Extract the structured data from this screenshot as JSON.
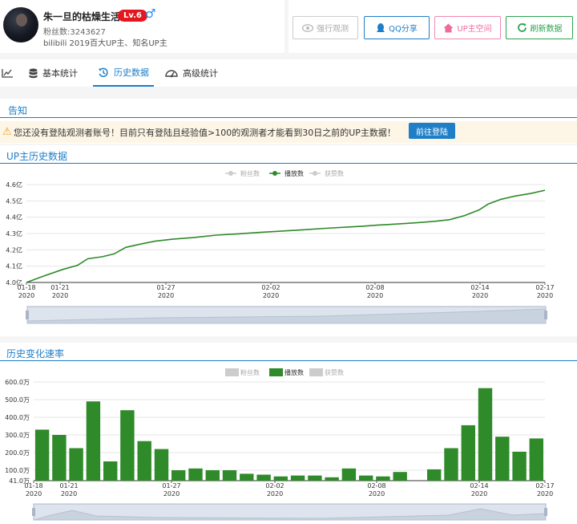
{
  "profile": {
    "name": "朱一旦的枯燥生活",
    "level": "Lv.6",
    "gender_symbol": "♂",
    "fans": "粉丝数:3243627",
    "description": "bilibili 2019百大UP主、知名UP主"
  },
  "actions": {
    "force_observe": "强行观测",
    "qq_share": "QQ分享",
    "up_space": "UP主空间",
    "refresh": "刷新数据"
  },
  "tabs": {
    "basic": "基本统计",
    "history": "历史数据",
    "advanced": "高级统计"
  },
  "notice": {
    "title": "告知",
    "message": "您还没有登陆观测者账号！目前只有登陆且经验值>100的观测者才能看到30日之前的UP主数据！",
    "login_button": "前往登陆"
  },
  "colors": {
    "accent": "#1e7ec8",
    "series": "#2f8a2a",
    "muted": "#cccccc"
  },
  "chart1_title": "UP主历史数据",
  "chart2_title": "历史变化速率",
  "chart_data": [
    {
      "type": "line",
      "title": "UP主历史数据",
      "legend": [
        "粉丝数",
        "播放数",
        "获赞数"
      ],
      "active_series": "播放数",
      "yticks": [
        "4.0亿",
        "4.1亿",
        "4.2亿",
        "4.3亿",
        "4.4亿",
        "4.5亿",
        "4.6亿"
      ],
      "xticks": [
        {
          "d": "01-18",
          "y": "2020"
        },
        {
          "d": "01-21",
          "y": "2020"
        },
        {
          "d": "01-27",
          "y": "2020"
        },
        {
          "d": "02-02",
          "y": "2020"
        },
        {
          "d": "02-08",
          "y": "2020"
        },
        {
          "d": "02-14",
          "y": "2020"
        },
        {
          "d": "02-17",
          "y": "2020"
        }
      ],
      "ylim": [
        4.0,
        4.6
      ],
      "series": [
        {
          "name": "播放数",
          "values": [
            [
              0,
              4.0
            ],
            [
              1.2,
              4.04
            ],
            [
              2.5,
              4.08
            ],
            [
              3.5,
              4.105
            ],
            [
              4.2,
              4.145
            ],
            [
              5.2,
              4.158
            ],
            [
              6,
              4.175
            ],
            [
              6.8,
              4.215
            ],
            [
              7.8,
              4.235
            ],
            [
              8.8,
              4.253
            ],
            [
              10,
              4.265
            ],
            [
              11.5,
              4.276
            ],
            [
              13,
              4.29
            ],
            [
              14.5,
              4.298
            ],
            [
              16,
              4.307
            ],
            [
              17.5,
              4.315
            ],
            [
              19,
              4.323
            ],
            [
              20.5,
              4.332
            ],
            [
              22,
              4.34
            ],
            [
              23,
              4.345
            ],
            [
              24,
              4.351
            ],
            [
              25,
              4.356
            ],
            [
              26,
              4.362
            ],
            [
              27,
              4.368
            ],
            [
              28,
              4.375
            ],
            [
              29,
              4.385
            ],
            [
              30,
              4.41
            ],
            [
              31,
              4.445
            ],
            [
              31.6,
              4.48
            ],
            [
              32.5,
              4.51
            ],
            [
              33.5,
              4.53
            ],
            [
              34.5,
              4.545
            ],
            [
              35.5,
              4.565
            ]
          ]
        }
      ]
    },
    {
      "type": "bar",
      "title": "历史变化速率",
      "legend": [
        "粉丝数",
        "播放数",
        "获赞数"
      ],
      "active_series": "播放数",
      "yticks": [
        "41.0万",
        "100.0万",
        "200.0万",
        "300.0万",
        "400.0万",
        "500.0万",
        "600.0万"
      ],
      "xticks": [
        {
          "d": "01-18",
          "y": "2020"
        },
        {
          "d": "01-21",
          "y": "2020"
        },
        {
          "d": "01-27",
          "y": "2020"
        },
        {
          "d": "02-02",
          "y": "2020"
        },
        {
          "d": "02-08",
          "y": "2020"
        },
        {
          "d": "02-14",
          "y": "2020"
        },
        {
          "d": "02-17",
          "y": "2020"
        }
      ],
      "ylim": [
        41,
        600
      ],
      "series": [
        {
          "name": "播放数",
          "values": [
            330,
            300,
            225,
            490,
            150,
            440,
            265,
            220,
            100,
            110,
            100,
            100,
            80,
            75,
            65,
            70,
            70,
            60,
            110,
            70,
            65,
            90,
            40,
            105,
            225,
            355,
            565,
            290,
            205,
            280
          ]
        }
      ]
    }
  ]
}
